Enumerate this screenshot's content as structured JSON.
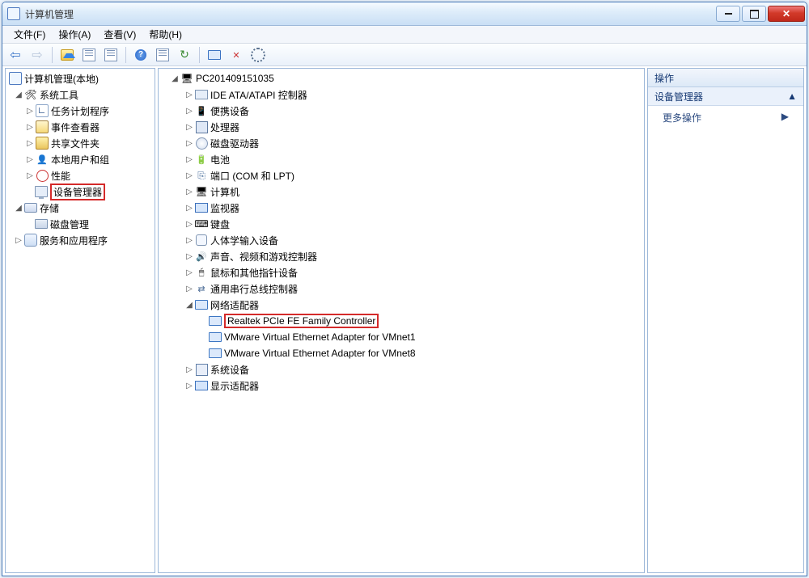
{
  "window": {
    "title": "计算机管理"
  },
  "menu": {
    "file": "文件(F)",
    "action": "操作(A)",
    "view": "查看(V)",
    "help": "帮助(H)"
  },
  "leftTree": {
    "root": "计算机管理(本地)",
    "systemTools": "系统工具",
    "taskScheduler": "任务计划程序",
    "eventViewer": "事件查看器",
    "sharedFolders": "共享文件夹",
    "localUsers": "本地用户和组",
    "performance": "性能",
    "deviceManager": "设备管理器",
    "storage": "存储",
    "diskMgmt": "磁盘管理",
    "services": "服务和应用程序"
  },
  "deviceTree": {
    "root": "PC201409151035",
    "ide": "IDE ATA/ATAPI 控制器",
    "portable": "便携设备",
    "cpu": "处理器",
    "cdrom": "磁盘驱动器",
    "battery": "电池",
    "ports": "端口 (COM 和 LPT)",
    "computer": "计算机",
    "monitor": "监视器",
    "keyboard": "键盘",
    "hid": "人体学输入设备",
    "sound": "声音、视频和游戏控制器",
    "mouse": "鼠标和其他指针设备",
    "usb": "通用串行总线控制器",
    "network": "网络适配器",
    "net_items": [
      "Realtek PCIe FE Family Controller",
      "VMware Virtual Ethernet Adapter for VMnet1",
      "VMware Virtual Ethernet Adapter for VMnet8"
    ],
    "system": "系统设备",
    "display": "显示适配器"
  },
  "actions": {
    "header": "操作",
    "category": "设备管理器",
    "more": "更多操作"
  }
}
